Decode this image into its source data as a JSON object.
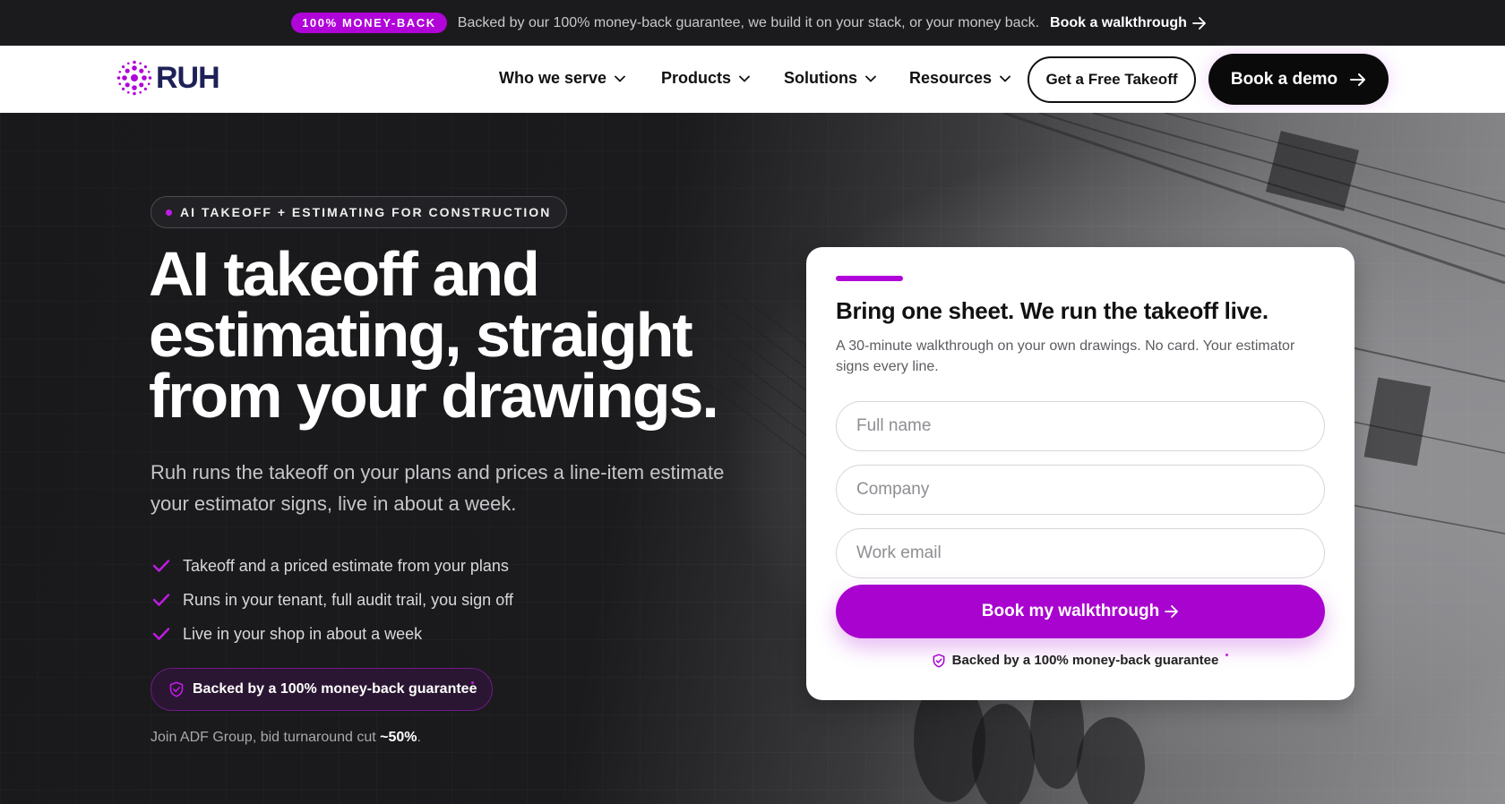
{
  "announcement": {
    "badge": "100% MONEY-BACK",
    "text": "Backed by our 100% money-back guarantee, we build it on your stack, or your money back.",
    "link": "Book a walkthrough"
  },
  "nav": {
    "logo_text": "RUH",
    "items": [
      {
        "label": "Who we serve"
      },
      {
        "label": "Products"
      },
      {
        "label": "Solutions"
      },
      {
        "label": "Resources"
      }
    ],
    "cta_secondary": "Get a Free Takeoff",
    "cta_primary": "Book a demo"
  },
  "hero": {
    "eyebrow": "AI TAKEOFF + ESTIMATING FOR CONSTRUCTION",
    "headline_lines": [
      "AI takeoff and",
      "estimating, straight",
      "from your drawings."
    ],
    "subhead": "Ruh runs the takeoff on your plans and prices a line-item estimate your estimator signs, live in about a week.",
    "checks": [
      "Takeoff and a priced estimate from your plans",
      "Runs in your tenant, full audit trail, you sign off",
      "Live in your shop in about a week"
    ],
    "guarantee": "Backed by a 100% money-back guarantee",
    "social_prefix": "Join ADF Group, bid turnaround cut",
    "social_value": "~50%",
    "social_suffix": "."
  },
  "form": {
    "title": "Bring one sheet. We run the takeoff live.",
    "subtitle": "A 30-minute walkthrough on your own drawings. No card. Your estimator signs every line.",
    "placeholders": {
      "name": "Full name",
      "company": "Company",
      "email": "Work email"
    },
    "submit": "Book my walkthrough",
    "guarantee": "Backed by a 100% money-back guarantee"
  },
  "colors": {
    "brand_purple": "#b004d8",
    "logo_navy": "#1e2156",
    "dark": "#0a0a0a"
  },
  "icons": {
    "announce_arrow": "arrow-right-icon",
    "dropdown": "chevron-down-icon",
    "check": "check-icon",
    "shield": "shield-check-icon",
    "logo_mark": "dot-cluster-logo-icon"
  }
}
